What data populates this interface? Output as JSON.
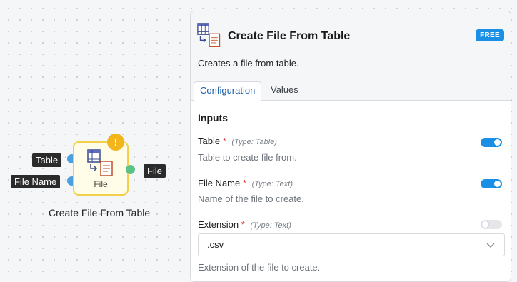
{
  "node": {
    "input_ports": [
      "Table",
      "File Name"
    ],
    "output_port": "File",
    "label": "File",
    "caption": "Create File From Table",
    "icon": "table-to-file-icon",
    "warning_icon": "warning-icon",
    "colors": {
      "input_port": "#4a9fe0",
      "output_port": "#5dc28a",
      "border": "#f2d04a",
      "warning": "#f2b51c"
    }
  },
  "panel": {
    "title": "Create File From Table",
    "badge": "FREE",
    "description": "Creates a file from table.",
    "tabs": [
      {
        "label": "Configuration",
        "active": true
      },
      {
        "label": "Values",
        "active": false
      }
    ],
    "section_title": "Inputs",
    "fields": [
      {
        "label": "Table",
        "required": "*",
        "type": "(Type: Table)",
        "help": "Table to create file from.",
        "toggle": true
      },
      {
        "label": "File Name",
        "required": "*",
        "type": "(Type: Text)",
        "help": "Name of the file to create.",
        "toggle": true
      },
      {
        "label": "Extension",
        "required": "*",
        "type": "(Type: Text)",
        "help": "Extension of the file to create.",
        "toggle": false,
        "value": ".csv"
      }
    ],
    "colors": {
      "accent": "#1a8fe6",
      "required": "#e0312e"
    }
  }
}
